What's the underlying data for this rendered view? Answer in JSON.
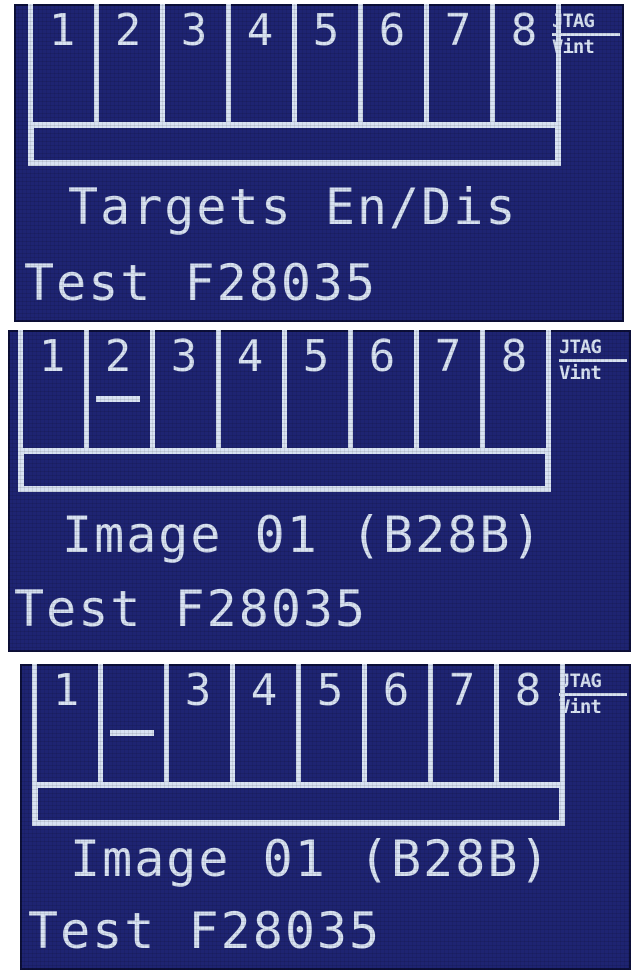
{
  "colors": {
    "screen_bg": "#1e2472",
    "pixel_fg": "#d8e2f2",
    "frame": "#ffffff"
  },
  "screens": [
    {
      "targets": [
        "1",
        "2",
        "3",
        "4",
        "5",
        "6",
        "7",
        "8"
      ],
      "brand": [
        "JTAG",
        "Vint"
      ],
      "message": "Targets En/Dis",
      "test_label": "Test F28035",
      "marked_targets": []
    },
    {
      "targets": [
        "1",
        "2",
        "3",
        "4",
        "5",
        "6",
        "7",
        "8"
      ],
      "brand": [
        "JTAG",
        "Vint"
      ],
      "message": "Image 01 (B28B)",
      "test_label": "Test F28035",
      "marked_targets": [
        "2"
      ]
    },
    {
      "targets": [
        "1",
        "",
        "3",
        "4",
        "5",
        "6",
        "7",
        "8"
      ],
      "brand": [
        "JTAG",
        "Vint"
      ],
      "message": "Image 01 (B28B)",
      "test_label": "Test F28035",
      "marked_targets": [
        "2"
      ]
    }
  ]
}
